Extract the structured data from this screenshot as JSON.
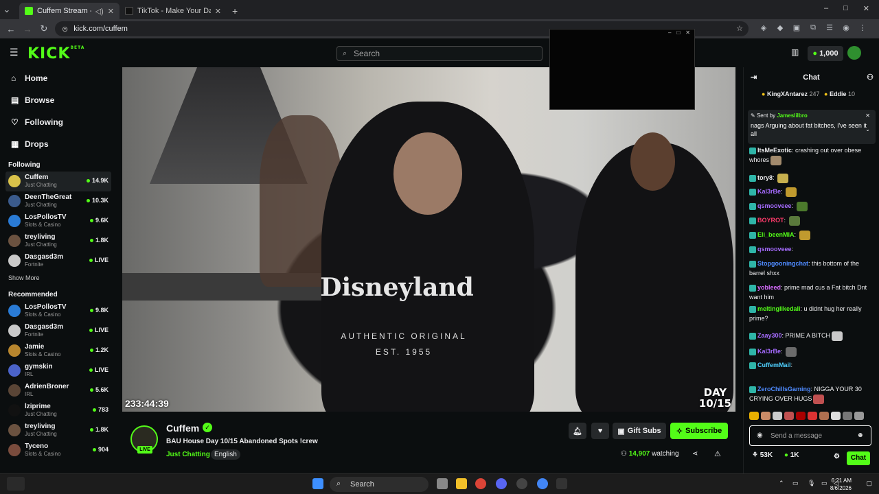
{
  "browser": {
    "tabs": [
      {
        "title": "Cuffem Stream - Watch Live on Kick",
        "active": true
      },
      {
        "title": "TikTok - Make Your Day",
        "active": false
      }
    ],
    "new_tab": "+",
    "url": "kick.com/cuffem",
    "window_controls": [
      "–",
      "□",
      "✕"
    ]
  },
  "header": {
    "logo": "KICK",
    "logo_tag": "BETA",
    "search_placeholder": "Search",
    "coins": "1,000"
  },
  "sidebar": {
    "main": [
      {
        "label": "Home",
        "icon": "home-icon",
        "glyph": "⌂"
      },
      {
        "label": "Browse",
        "icon": "browse-icon",
        "glyph": "▤"
      },
      {
        "label": "Following",
        "icon": "heart-icon",
        "glyph": "♡"
      },
      {
        "label": "Drops",
        "icon": "drops-icon",
        "glyph": "▦"
      }
    ],
    "following_title": "Following",
    "following": [
      {
        "name": "Cuffem",
        "category": "Just Chatting",
        "viewers": "14.9K",
        "color": "#d9c24a"
      },
      {
        "name": "DeenTheGreat",
        "category": "Just Chatting",
        "viewers": "10.3K",
        "color": "#3b5b8c"
      },
      {
        "name": "LosPollosTV",
        "category": "Slots & Casino",
        "viewers": "9.6K",
        "color": "#2a7bd5"
      },
      {
        "name": "treyliving",
        "category": "Just Chatting",
        "viewers": "1.8K",
        "color": "#6b5240"
      },
      {
        "name": "Dasgasd3m",
        "category": "Fortnite",
        "viewers": "LIVE",
        "color": "#c9c9c9"
      }
    ],
    "show_more": "Show More",
    "recommended_title": "Recommended",
    "recommended": [
      {
        "name": "LosPollosTV",
        "category": "Slots & Casino",
        "viewers": "9.8K",
        "color": "#2a7bd5"
      },
      {
        "name": "Dasgasd3m",
        "category": "Fortnite",
        "viewers": "LIVE",
        "color": "#c9c9c9"
      },
      {
        "name": "Jamie",
        "category": "Slots & Casino",
        "viewers": "1.2K",
        "color": "#b8862e"
      },
      {
        "name": "gymskin",
        "category": "IRL",
        "viewers": "LIVE",
        "color": "#4b63c9"
      },
      {
        "name": "AdrienBroner",
        "category": "IRL",
        "viewers": "5.6K",
        "color": "#5a4536"
      },
      {
        "name": "lziprime",
        "category": "Just Chatting",
        "viewers": "783",
        "color": "#111111"
      },
      {
        "name": "treyliving",
        "category": "Just Chatting",
        "viewers": "1.8K",
        "color": "#6b5240"
      },
      {
        "name": "Tyceno",
        "category": "Slots & Casino",
        "viewers": "904",
        "color": "#7a4c3d"
      }
    ]
  },
  "video": {
    "timer": "233:44:39",
    "day_line1": "DAY",
    "day_line2": "10/15",
    "shirt_text": "Disneyland",
    "shirt_sub1": "AUTHENTIC ORIGINAL",
    "shirt_sub2": "EST. 1955"
  },
  "stream": {
    "channel": "Cuffem",
    "live_label": "LIVE",
    "title": "BAU House Day 10/15 Abandoned Spots !crew",
    "category": "Just Chatting",
    "language": "English",
    "gift_subs": "Gift Subs",
    "subscribe": "Subscribe",
    "viewers": "14,907",
    "watching_label": "watching"
  },
  "chat": {
    "title": "Chat",
    "gifters": [
      {
        "name": "KingXAntarez",
        "count": "247"
      },
      {
        "name": "Eddie",
        "count": "10"
      }
    ],
    "pinned_sender_prefix": "Sent by",
    "pinned_sender": "Jameslilbro",
    "pinned_message": "nags Arguing about fat bitches, I've seen it all",
    "messages": [
      {
        "user": "ItsMeExotic",
        "color": "#efeff1",
        "text": "crashing out over obese whores"
      },
      {
        "user": "tory8",
        "color": "#efeff1",
        "text": ""
      },
      {
        "user": "Kal3rBe",
        "color": "#a66cff",
        "text": ""
      },
      {
        "user": "qsmooveee",
        "color": "#a66cff",
        "text": ""
      },
      {
        "user": "BOYROT",
        "color": "#ff3b6b",
        "text": ""
      },
      {
        "user": "Eli_beenMIA",
        "color": "#53fc18",
        "text": ""
      },
      {
        "user": "qsmooveee",
        "color": "#a66cff",
        "text": ""
      },
      {
        "user": "Stopgooningchat",
        "color": "#4f8bff",
        "text": "this bottom of the barrel shxx"
      },
      {
        "user": "yobleed",
        "color": "#d86cff",
        "text": "prime mad cus a Fat bitch Dnt want him"
      },
      {
        "user": "meltinglikedali",
        "color": "#53fc18",
        "text": "u didnt hug her really prime?"
      },
      {
        "user": "Zaay300",
        "color": "#a66cff",
        "text": "PRIME A BITCH"
      },
      {
        "user": "Kal3rBe",
        "color": "#a66cff",
        "text": ""
      },
      {
        "user": "CuffemMail",
        "color": "#4fd0ff",
        "text": ""
      },
      {
        "user": "ZeroChillsGaming",
        "color": "#4f8bff",
        "text": "NIGGA YOUR 30 CRYING OVER HUGS"
      }
    ],
    "input_placeholder": "Send a message",
    "stat1": "53K",
    "stat2": "1K",
    "chat_button": "Chat"
  },
  "taskbar": {
    "search": "Search",
    "time": "6:21 AM",
    "date": "8/6/2026"
  },
  "colors": {
    "kick_green": "#53fc18",
    "background": "#0b0e0f"
  }
}
